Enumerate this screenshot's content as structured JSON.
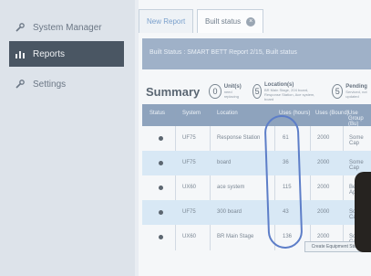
{
  "sidebar": {
    "items": [
      {
        "label": "System Manager",
        "icon": "wrench-icon"
      },
      {
        "label": "Reports",
        "icon": "bar-chart-icon"
      },
      {
        "label": "Settings",
        "icon": "wrench-icon"
      }
    ]
  },
  "tabs": [
    {
      "label": "New Report"
    },
    {
      "label": "Built status"
    }
  ],
  "banner": {
    "text": "Built Status : SMART BETT Report 2/15, Built status"
  },
  "summary": {
    "title": "Summary",
    "units": {
      "count": "0",
      "label": "Unit(s)",
      "sub": "need replacing"
    },
    "locations": {
      "count": "5",
      "label": "Location(s)",
      "sub": "BR Main Stage, 204 board, Response Station, Ace system, board"
    },
    "pending": {
      "count": "5",
      "label": "Pending",
      "sub": "Serviced, not updated"
    }
  },
  "table": {
    "headers": [
      "Status",
      "System",
      "Location",
      "Uses (hours)",
      "Uses (Bound)",
      "Use Group (Bu)"
    ],
    "rows": [
      {
        "system": "UF75",
        "location": "Response Station",
        "uses_hours": "61",
        "uses_bound": "2000",
        "group": "Some Cap"
      },
      {
        "system": "UF75",
        "location": "board",
        "uses_hours": "36",
        "uses_bound": "2000",
        "group": "Some Cap"
      },
      {
        "system": "UX60",
        "location": "ace system",
        "uses_hours": "115",
        "uses_bound": "2000",
        "group": "Between Ap"
      },
      {
        "system": "UF75",
        "location": "300 board",
        "uses_hours": "43",
        "uses_bound": "2000",
        "group": "Some Cap"
      },
      {
        "system": "UX60",
        "location": "BR Main Stage",
        "uses_hours": "136",
        "uses_bound": "2000",
        "group": "Some Cap"
      }
    ]
  },
  "footer": {
    "button_label": "Create Equipment Stage"
  },
  "colors": {
    "sidebar_active": "#4a5663",
    "table_header": "#8ea3bd",
    "row_highlight": "#d8e8f5",
    "annotation_ring": "#5d7ec8"
  }
}
